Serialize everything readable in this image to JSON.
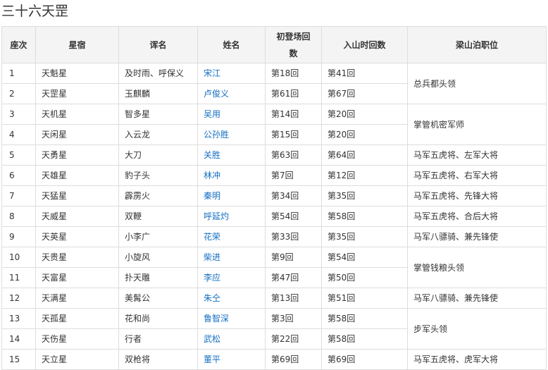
{
  "title": "三十六天罡",
  "link_color": "#136ec2",
  "headers": {
    "rank": "座次",
    "star": "星宿",
    "nickname": "诨名",
    "name": "姓名",
    "first_chapter": "初登场回数",
    "join_chapter": "入山时回数",
    "position": "梁山泊职位"
  },
  "rows": [
    {
      "rank": "1",
      "star": "天魁星",
      "nickname": "及时雨、呼保义",
      "name": "宋江",
      "first": "第18回",
      "join": "第41回"
    },
    {
      "rank": "2",
      "star": "天罡星",
      "nickname": "玉麒麟",
      "name": "卢俊义",
      "first": "第61回",
      "join": "第67回"
    },
    {
      "rank": "3",
      "star": "天机星",
      "nickname": "智多星",
      "name": "吴用",
      "first": "第14回",
      "join": "第20回"
    },
    {
      "rank": "4",
      "star": "天闲星",
      "nickname": "入云龙",
      "name": "公孙胜",
      "first": "第15回",
      "join": "第20回"
    },
    {
      "rank": "5",
      "star": "天勇星",
      "nickname": "大刀",
      "name": "关胜",
      "first": "第63回",
      "join": "第64回"
    },
    {
      "rank": "6",
      "star": "天雄星",
      "nickname": "豹子头",
      "name": "林冲",
      "first": "第7回",
      "join": "第12回"
    },
    {
      "rank": "7",
      "star": "天猛星",
      "nickname": "霹雳火",
      "name": "秦明",
      "first": "第34回",
      "join": "第35回"
    },
    {
      "rank": "8",
      "star": "天威星",
      "nickname": "双鞭",
      "name": "呼延灼",
      "first": "第54回",
      "join": "第58回"
    },
    {
      "rank": "9",
      "star": "天英星",
      "nickname": "小李广",
      "name": "花荣",
      "first": "第33回",
      "join": "第35回"
    },
    {
      "rank": "10",
      "star": "天贵星",
      "nickname": "小旋风",
      "name": "柴进",
      "first": "第9回",
      "join": "第54回"
    },
    {
      "rank": "11",
      "star": "天富星",
      "nickname": "扑天雕",
      "name": "李应",
      "first": "第47回",
      "join": "第50回"
    },
    {
      "rank": "12",
      "star": "天满星",
      "nickname": "美髯公",
      "name": "朱仝",
      "first": "第13回",
      "join": "第51回"
    },
    {
      "rank": "13",
      "star": "天孤星",
      "nickname": "花和尚",
      "name": "鲁智深",
      "first": "第3回",
      "join": "第58回"
    },
    {
      "rank": "14",
      "star": "天伤星",
      "nickname": "行者",
      "name": "武松",
      "first": "第22回",
      "join": "第58回"
    },
    {
      "rank": "15",
      "star": "天立星",
      "nickname": "双枪将",
      "name": "董平",
      "first": "第69回",
      "join": "第69回"
    }
  ],
  "positions": [
    "总兵都头领",
    "掌管机密军师",
    "马军五虎将、左军大将",
    "马军五虎将、右军大将",
    "马军五虎将、先锋大将",
    "马军五虎将、合后大将",
    "马军八骠骑、兼先锋使",
    "掌管钱粮头领",
    "马军八骠骑、兼先锋使",
    "步军头领",
    "马军五虎将、虎军大将"
  ]
}
